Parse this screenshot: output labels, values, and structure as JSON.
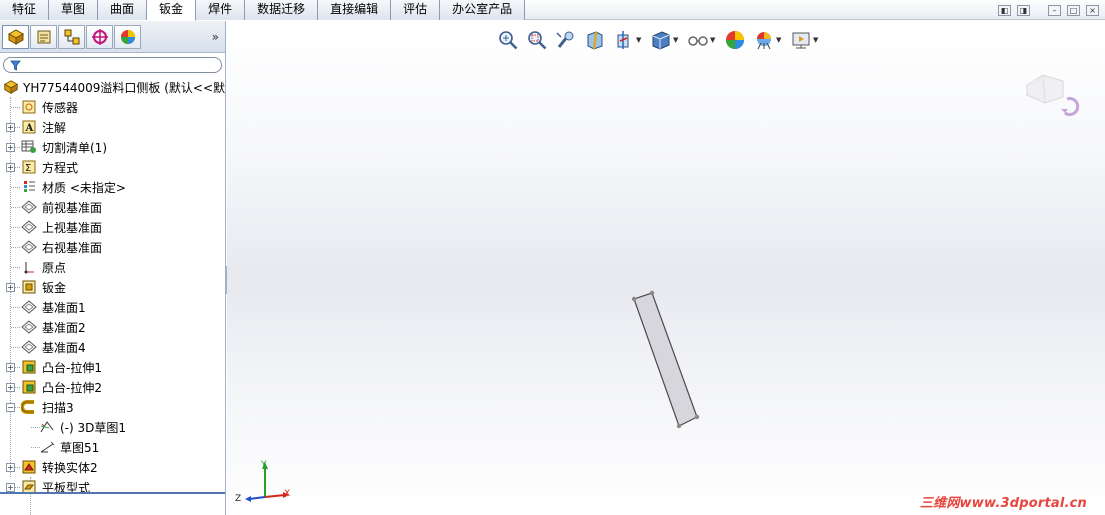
{
  "tabs": [
    "特征",
    "草图",
    "曲面",
    "钣金",
    "焊件",
    "数据迁移",
    "直接编辑",
    "评估",
    "办公室产品"
  ],
  "active_tab": "钣金",
  "window_controls": [
    "◧",
    "◨",
    "–",
    "□",
    "×"
  ],
  "panel_tabs": [
    "feature-manager",
    "property-manager",
    "configuration-manager",
    "dim-xpert",
    "display-manager"
  ],
  "panel_more": "»",
  "tree": {
    "root": "YH77544009溢料口侧板  (默认<<默认",
    "items": [
      {
        "label": "传感器",
        "icon": "sensor-icon",
        "expandable": false
      },
      {
        "label": "注解",
        "icon": "annotation-icon",
        "expandable": true
      },
      {
        "label": "切割清单(1)",
        "icon": "cutlist-icon",
        "expandable": true
      },
      {
        "label": "方程式",
        "icon": "equation-icon",
        "expandable": true
      },
      {
        "label": "材质 <未指定>",
        "icon": "material-icon",
        "expandable": false
      },
      {
        "label": "前视基准面",
        "icon": "plane-icon",
        "expandable": false
      },
      {
        "label": "上视基准面",
        "icon": "plane-icon",
        "expandable": false
      },
      {
        "label": "右视基准面",
        "icon": "plane-icon",
        "expandable": false
      },
      {
        "label": "原点",
        "icon": "origin-icon",
        "expandable": false
      },
      {
        "label": "钣金",
        "icon": "sheetmetal-icon",
        "expandable": true
      },
      {
        "label": "基准面1",
        "icon": "plane-icon",
        "expandable": false
      },
      {
        "label": "基准面2",
        "icon": "plane-icon",
        "expandable": false
      },
      {
        "label": "基准面4",
        "icon": "plane-icon",
        "expandable": false
      },
      {
        "label": "凸台-拉伸1",
        "icon": "boss-extrude-icon",
        "expandable": true
      },
      {
        "label": "凸台-拉伸2",
        "icon": "boss-extrude-icon",
        "expandable": true
      },
      {
        "label": "扫描3",
        "icon": "sweep-icon",
        "expandable": true,
        "expanded": true
      },
      {
        "label": "(-) 3D草图1",
        "icon": "sketch3d-icon",
        "child": true
      },
      {
        "label": "草图51",
        "icon": "sketch-icon",
        "child": true
      },
      {
        "label": "转换实体2",
        "icon": "convert-entity-icon",
        "expandable": true
      },
      {
        "label": "平板型式",
        "icon": "flat-pattern-icon",
        "expandable": true
      }
    ]
  },
  "triad_labels": {
    "y": "Y",
    "z": "Z",
    "x": "X"
  },
  "watermark": "三维网www.3dportal.cn",
  "colors": {
    "accent": "#5177b1",
    "part": "#d7d6dc",
    "watermark": "#e8453c"
  }
}
